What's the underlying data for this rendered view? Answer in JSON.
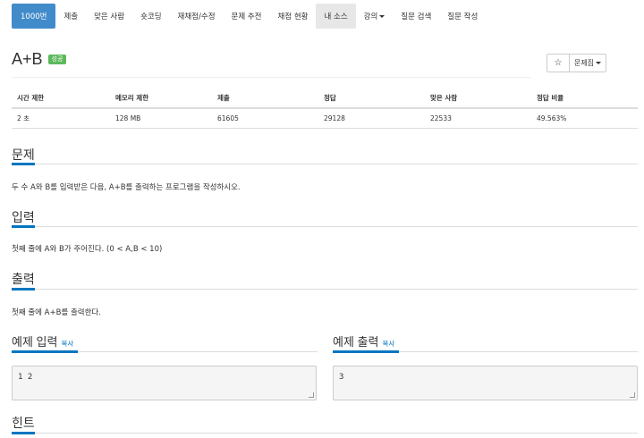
{
  "nav": {
    "items": [
      {
        "label": "1000번"
      },
      {
        "label": "제출"
      },
      {
        "label": "맞은 사람"
      },
      {
        "label": "숏코딩"
      },
      {
        "label": "재채점/수정"
      },
      {
        "label": "문제 추전"
      },
      {
        "label": "채점 현황"
      },
      {
        "label": "내 소스"
      },
      {
        "label": "강의"
      },
      {
        "label": "질문 검색"
      },
      {
        "label": "질문 작성"
      }
    ]
  },
  "problem": {
    "title": "A+B",
    "badge": "성공",
    "star": "☆",
    "set_button": "문제집"
  },
  "info": {
    "headers": [
      "시간 제한",
      "메모리 제한",
      "제출",
      "정답",
      "맞은 사람",
      "정답 비율"
    ],
    "values": [
      "2 초",
      "128 MB",
      "61605",
      "29128",
      "22533",
      "49.563%"
    ]
  },
  "sections": {
    "problem_title": "문제",
    "problem_text": "두 수 A와 B를 입력받은 다음, A+B를 출력하는 프로그램을 작성하시오.",
    "input_title": "입력",
    "input_text": "첫째 줄에 A와 B가 주어진다. (0 < A,B < 10)",
    "output_title": "출력",
    "output_text": "첫째 줄에 A+B를 출력한다.",
    "hint_title": "힌트"
  },
  "samples": {
    "input_title": "예제 입력",
    "output_title": "예제 출력",
    "copy_label": "복사",
    "input_value": "1 2",
    "output_value": "3"
  },
  "colors": {
    "primary": "#428bca",
    "success": "#5cb85c",
    "accent": "#0076c0"
  }
}
